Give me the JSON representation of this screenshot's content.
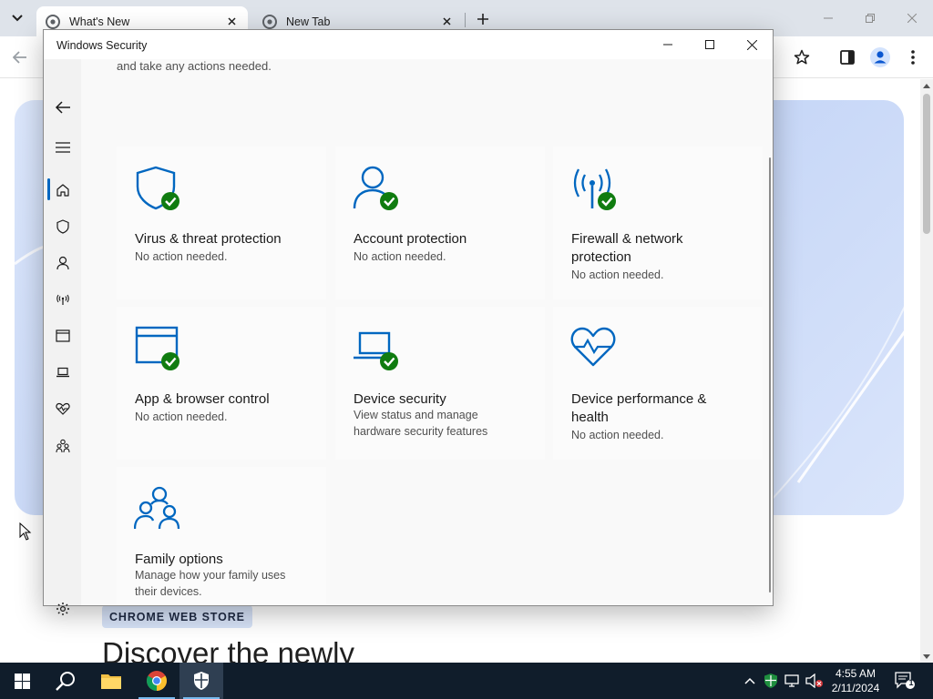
{
  "browser": {
    "tabs": [
      {
        "title": "What's New",
        "active": true
      },
      {
        "title": "New Tab",
        "active": false
      }
    ],
    "page": {
      "store_chip": "CHROME WEB STORE",
      "heading": "Discover the newly"
    }
  },
  "security_window": {
    "title": "Windows Security",
    "top_text": "and take any actions needed.",
    "nav": [
      "back",
      "menu",
      "home",
      "virus-threat",
      "account",
      "firewall",
      "app-browser",
      "device-security",
      "device-performance",
      "family",
      "settings"
    ],
    "cards": [
      {
        "title": "Virus & threat protection",
        "subtitle": "No action needed.",
        "icon": "shield-icon",
        "status": "ok"
      },
      {
        "title": "Account protection",
        "subtitle": "No action needed.",
        "icon": "person-icon",
        "status": "ok"
      },
      {
        "title": "Firewall & network protection",
        "subtitle": "No action needed.",
        "icon": "antenna-icon",
        "status": "ok"
      },
      {
        "title": "App & browser control",
        "subtitle": "No action needed.",
        "icon": "app-window-icon",
        "status": "ok"
      },
      {
        "title": "Device security",
        "subtitle": "View status and manage hardware security features",
        "icon": "laptop-icon",
        "status": "ok"
      },
      {
        "title": "Device performance & health",
        "subtitle": "No action needed.",
        "icon": "heart-pulse-icon",
        "status": "none"
      },
      {
        "title": "Family options",
        "subtitle": "Manage how your family uses their devices.",
        "icon": "family-icon",
        "status": "none"
      }
    ]
  },
  "taskbar": {
    "time": "4:55 AM",
    "date": "2/11/2024",
    "notification_count": "1"
  },
  "colors": {
    "accent": "#0067c0",
    "ok_green": "#107c10",
    "taskbar": "#101d2b"
  }
}
